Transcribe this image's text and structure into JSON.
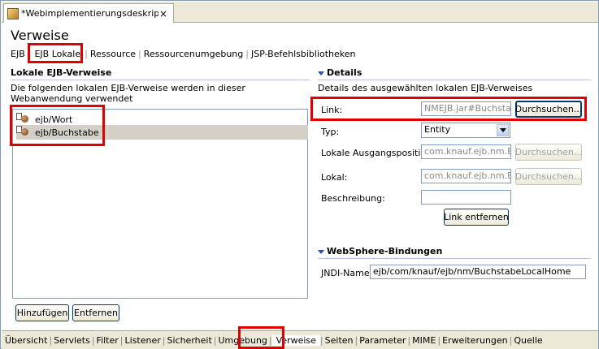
{
  "editor_tab": {
    "title": "*Webimplementierungsdeskriptor",
    "close_icon": "×"
  },
  "page_title": "Verweise",
  "subtabs": [
    "EJB",
    "EJB Lokale",
    "Ressource",
    "Ressourcenumgebung",
    "JSP-Befehlsbibliotheken"
  ],
  "left": {
    "header": "Lokale EJB-Verweise",
    "description": "Die folgenden lokalen EJB-Verweise werden in dieser Webanwendung verwendet",
    "items": [
      {
        "label": "ejb/Wort",
        "selected": false
      },
      {
        "label": "ejb/Buchstabe",
        "selected": true
      }
    ],
    "add_button": "Hinzufügen",
    "remove_button": "Entfernen"
  },
  "details": {
    "header": "Details",
    "description": "Details des ausgewählten lokalen EJB-Verweises",
    "link_label": "Link:",
    "link_value": "NMEJB.jar#Buchstab",
    "browse_label": "Durchsuchen...",
    "type_label": "Typ:",
    "type_value": "Entity",
    "home_label": "Lokale Ausgangsposition:",
    "home_value": "com.knauf.ejb.nm.Bu",
    "local_label": "Lokal:",
    "local_value": "com.knauf.ejb.nm.Bu",
    "desc_label": "Beschreibung:",
    "desc_value": "",
    "remove_link_button": "Link entfernen"
  },
  "websphere": {
    "header": "WebSphere-Bindungen",
    "jndi_label": "JNDI-Name:",
    "jndi_value": "ejb/com/knauf/ejb/nm/BuchstabeLocalHome"
  },
  "bottom_tabs": [
    "Übersicht",
    "Servlets",
    "Filter",
    "Listener",
    "Sicherheit",
    "Umgebung",
    "Verweise",
    "Seiten",
    "Parameter",
    "MIME",
    "Erweiterungen",
    "Quelle"
  ],
  "colors": {
    "highlight": "#e00000",
    "section_header": "#000000"
  }
}
